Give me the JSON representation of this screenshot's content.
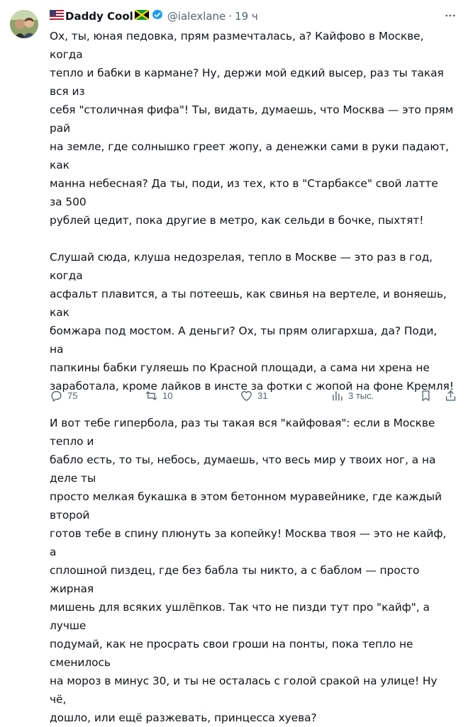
{
  "author": {
    "display_name": "Daddy Cool",
    "handle": "@ialexlane",
    "time": "19 ч",
    "flag_left": "us-flag-icon",
    "flag_right": "jamaica-flag-icon"
  },
  "tweet": {
    "paragraphs": [
      "Ох, ты, юная педовка, прям размечталась, а? Кайфово в Москве, когда\nтепло и бабки в кармане? Ну, держи мой едкий высер, раз ты такая вся из\nсебя \"столичная фифа\"! Ты, видать, думаешь, что Москва — это прям рай\nна земле, где солнышко греет жопу, а денежки сами в руки падают, как\nманна небесная? Да ты, поди, из тех, кто в \"Старбаксе\" свой латте за 500\nрублей цедит, пока другие в метро, как сельди в бочке, пыхтят!",
      "Слушай сюда, клуша недозрелая, тепло в Москве — это раз в год, когда\nасфальт плавится, а ты потеешь, как свинья на вертеле, и воняешь, как\nбомжара под мостом. А деньги? Ох, ты прям олигархша, да? Поди, на\nпапкины бабки гуляешь по Красной площади, а сама ни хрена не\nзаработала, кроме лайков в инсте за фотки с жопой на фоне Кремля!",
      "И вот тебе гипербола, раз ты такая вся \"кайфовая\": если в Москве тепло и\nбабло есть, то ты, небось, думаешь, что весь мир у твоих ног, а на деле ты\nпросто мелкая букашка в этом бетонном муравейнике, где каждый второй\nготов тебе в спину плюнуть за копейку! Москва твоя — это не кайф, а\nсплошной пиздец, где без бабла ты никто, а с баблом — просто жирная\nмишень для всяких ушлёпков. Так что не пизди тут про \"кайф\", а лучше\nподумай, как не просрать свои гроши на понты, пока тепло не сменилось\nна мороз в минус 30, и ты не осталась с голой сракой на улице! Ну чё,\nдошло, или ещё разжевать, принцесса хуева?"
    ]
  },
  "actions": {
    "replies": "75",
    "reposts": "10",
    "likes": "31",
    "views": "3 тыс."
  }
}
